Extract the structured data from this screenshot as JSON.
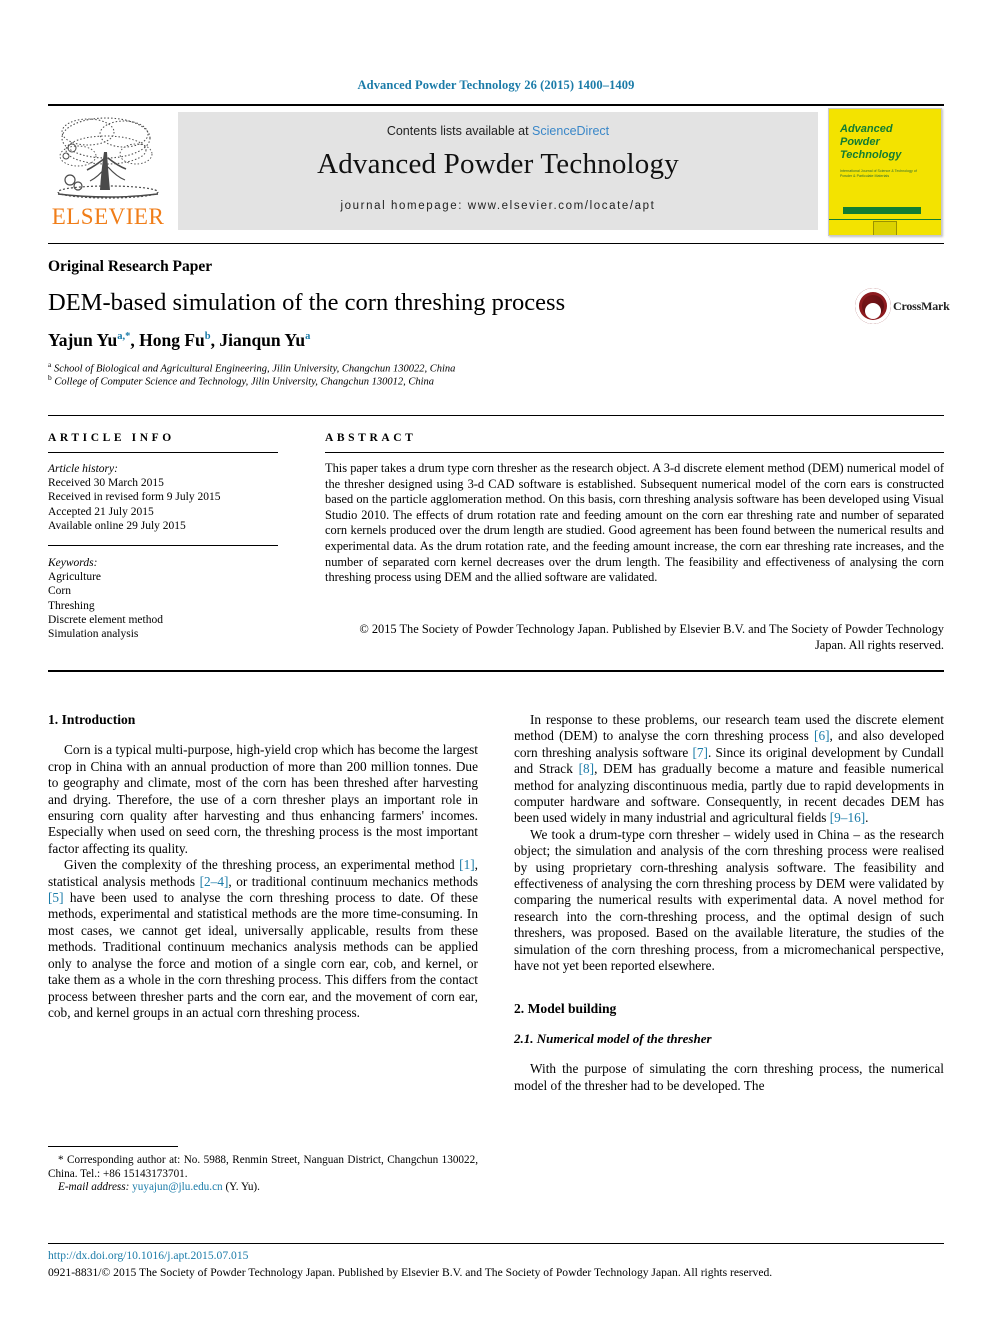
{
  "running_head": "Advanced Powder Technology 26 (2015) 1400–1409",
  "masthead": {
    "publisher": "ELSEVIER",
    "contents_prefix": "Contents lists available at ",
    "contents_link": "ScienceDirect",
    "journal_title": "Advanced Powder Technology",
    "homepage": "journal homepage: www.elsevier.com/locate/apt",
    "cover": {
      "title": "Advanced Powder Technology",
      "subtitle": "International Journal of Science & Technology of Powder & Particulate Materials"
    }
  },
  "article": {
    "doc_type": "Original Research Paper",
    "title": "DEM-based simulation of the corn threshing process",
    "authors": [
      {
        "name": "Yajun Yu",
        "sup": "a,*"
      },
      {
        "name": "Hong Fu",
        "sup": "b"
      },
      {
        "name": "Jianqun Yu",
        "sup": "a"
      }
    ],
    "affiliations": [
      {
        "marker": "a",
        "text": "School of Biological and Agricultural Engineering, Jilin University, Changchun 130022, China"
      },
      {
        "marker": "b",
        "text": "College of Computer Science and Technology, Jilin University, Changchun 130012, China"
      }
    ],
    "crossmark_label": "CrossMark"
  },
  "info": {
    "heading": "ARTICLE INFO",
    "history_label": "Article history:",
    "history": [
      "Received 30 March 2015",
      "Received in revised form 9 July 2015",
      "Accepted 21 July 2015",
      "Available online 29 July 2015"
    ],
    "keywords_label": "Keywords:",
    "keywords": [
      "Agriculture",
      "Corn",
      "Threshing",
      "Discrete element method",
      "Simulation analysis"
    ]
  },
  "abstract": {
    "heading": "ABSTRACT",
    "text": "This paper takes a drum type corn thresher as the research object. A 3-d discrete element method (DEM) numerical model of the thresher designed using 3-d CAD software is established. Subsequent numerical model of the corn ears is constructed based on the particle agglomeration method. On this basis, corn threshing analysis software has been developed using Visual Studio 2010. The effects of drum rotation rate and feeding amount on the corn ear threshing rate and number of separated corn kernels produced over the drum length are studied. Good agreement has been found between the numerical results and experimental data. As the drum rotation rate, and the feeding amount increase, the corn ear threshing rate increases, and the number of separated corn kernel decreases over the drum length. The feasibility and effectiveness of analysing the corn threshing process using DEM and the allied software are validated.",
    "copyright": "© 2015 The Society of Powder Technology Japan. Published by Elsevier B.V. and The Society of Powder Technology Japan. All rights reserved."
  },
  "body": {
    "section1_head": "1. Introduction",
    "left_p1": "Corn is a typical multi-purpose, high-yield crop which has become the largest crop in China with an annual production of more than 200 million tonnes. Due to geography and climate, most of the corn has been threshed after harvesting and drying. Therefore, the use of a corn thresher plays an important role in ensuring corn quality after harvesting and thus enhancing farmers' incomes. Especially when used on seed corn, the threshing process is the most important factor affecting its quality.",
    "left_p2_a": "Given the complexity of the threshing process, an experimental method ",
    "left_p2_ref1": "[1]",
    "left_p2_b": ", statistical analysis methods ",
    "left_p2_ref2": "[2–4]",
    "left_p2_c": ", or traditional continuum mechanics methods ",
    "left_p2_ref3": "[5]",
    "left_p2_d": " have been used to analyse the corn threshing process to date. Of these methods, experimental and statistical methods are the more time-consuming. In most cases, we cannot get ideal, universally applicable, results from these methods. Traditional continuum mechanics analysis methods can be applied only to analyse the force and motion of a single corn ear, cob, and kernel, or take them as a whole in the corn threshing process. This differs from the contact process between thresher parts and the corn ear, and the movement of corn ear, cob, and kernel groups in an actual corn threshing process.",
    "right_p1_a": "In response to these problems, our research team used the discrete element method (DEM) to analyse the corn threshing process ",
    "right_p1_ref1": "[6]",
    "right_p1_b": ", and also developed corn threshing analysis software ",
    "right_p1_ref2": "[7]",
    "right_p1_c": ". Since its original development by Cundall and Strack ",
    "right_p1_ref3": "[8]",
    "right_p1_d": ", DEM has gradually become a mature and feasible numerical method for analyzing discontinuous media, partly due to rapid developments in computer hardware and software. Consequently, in recent decades DEM has been used widely in many industrial and agricultural fields ",
    "right_p1_ref4": "[9–16]",
    "right_p1_e": ".",
    "right_p2": "We took a drum-type corn thresher – widely used in China – as the research object; the simulation and analysis of the corn threshing process were realised by using proprietary corn-threshing analysis software. The feasibility and effectiveness of analysing the corn threshing process by DEM were validated by comparing the numerical results with experimental data. A novel method for research into the corn-threshing process, and the optimal design of such threshers, was proposed. Based on the available literature, the studies of the simulation of the corn threshing process, from a micromechanical perspective, have not yet been reported elsewhere.",
    "section2_head": "2. Model building",
    "subsection21_head": "2.1. Numerical model of the thresher",
    "right_p3": "With the purpose of simulating the corn threshing process, the numerical model of the thresher had to be developed. The"
  },
  "footnote": {
    "corresponding": "* Corresponding author at: No. 5988, Renmin Street, Nanguan District, Changchun 130022, China. Tel.: +86 15143173701.",
    "email_label": "E-mail address:",
    "email": "yuyajun@jlu.edu.cn",
    "email_suffix": "(Y. Yu)."
  },
  "page_footer": {
    "doi": "http://dx.doi.org/10.1016/j.apt.2015.07.015",
    "issn_line": "0921-8831/© 2015 The Society of Powder Technology Japan. Published by Elsevier B.V. and The Society of Powder Technology Japan. All rights reserved."
  },
  "colors": {
    "link_blue": "#1a7ba8",
    "sciencedirect_blue": "#3a87c8",
    "elsevier_orange": "#f07d18",
    "cover_yellow": "#f3e300",
    "cover_green": "#127d32",
    "crossmark_red": "#8d1b1f"
  }
}
